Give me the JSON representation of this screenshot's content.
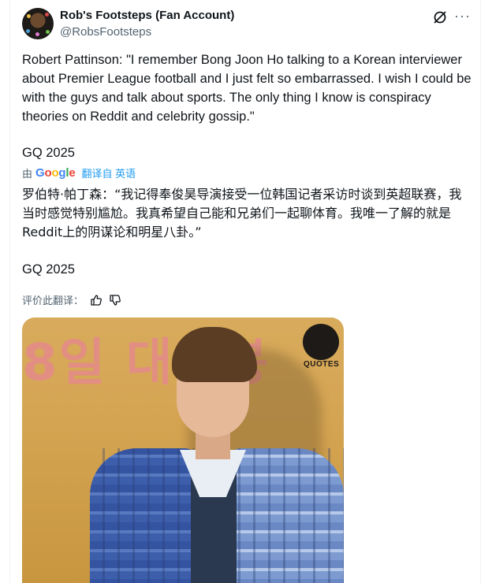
{
  "author": {
    "name": "Rob's Footsteps (Fan Account)",
    "handle": "@RobsFootsteps"
  },
  "tweet": {
    "text": "Robert Pattinson: \"I remember Bong Joon Ho talking to a Korean interviewer about Premier League football and I just felt so embarrassed. I wish I could be with the guys and talk about sports. The only thing I know is conspiracy theories on Reddit and celebrity gossip.\"",
    "source": "GQ 2025"
  },
  "translation": {
    "by_label": "由",
    "provider": "Google",
    "link_label": "翻译自 英语",
    "text": "罗伯特·帕丁森：“我记得奉俊昊导演接受一位韩国记者采访时谈到英超联赛，我当时感觉特别尴尬。我真希望自己能和兄弟们一起聊体育。我唯一了解的就是Reddit上的阴谋论和明星八卦。”",
    "source": "GQ 2025",
    "rate_label": "评价此翻译："
  },
  "media": {
    "background_text": "8일 대개봉",
    "badge_label": "QUOTES"
  },
  "icons": {
    "grok": "grok-icon",
    "more": "more-icon",
    "thumbs_up": "thumbs-up-icon",
    "thumbs_down": "thumbs-down-icon"
  },
  "colors": {
    "link": "#1d9bf0",
    "secondary_text": "#536471"
  }
}
